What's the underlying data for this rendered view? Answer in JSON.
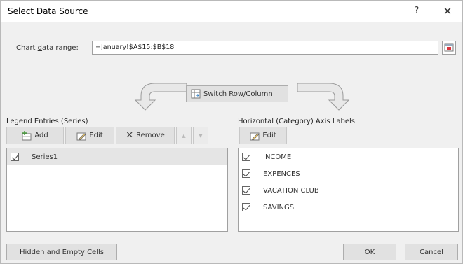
{
  "window": {
    "title": "Select Data Source",
    "help": "?",
    "close": "✕"
  },
  "range": {
    "label": "Chart data range:",
    "value": "=January!$A$15:$B$18"
  },
  "switch_button": {
    "label": "Switch Row/Column"
  },
  "legend": {
    "label": "Legend Entries (Series)",
    "add_label": "Add",
    "edit_label": "Edit",
    "remove_label": "Remove",
    "up_label": "▲",
    "down_label": "▼",
    "series": [
      {
        "label": "Series1",
        "checked": true,
        "selected": true
      }
    ]
  },
  "axis": {
    "label": "Horizontal (Category) Axis Labels",
    "edit_label": "Edit",
    "items": [
      {
        "label": "INCOME",
        "checked": true
      },
      {
        "label": "EXPENCES",
        "checked": true
      },
      {
        "label": "VACATION CLUB",
        "checked": true
      },
      {
        "label": "SAVINGS",
        "checked": true
      }
    ]
  },
  "footer": {
    "hidden_cells_label": "Hidden and Empty Cells",
    "ok_label": "OK",
    "cancel_label": "Cancel"
  },
  "colors": {
    "dialog_bg": "#f0f0f0",
    "button_bg": "#e1e1e1",
    "accent_icon_red": "#d9363e",
    "icon_green": "#4a9a3f"
  }
}
